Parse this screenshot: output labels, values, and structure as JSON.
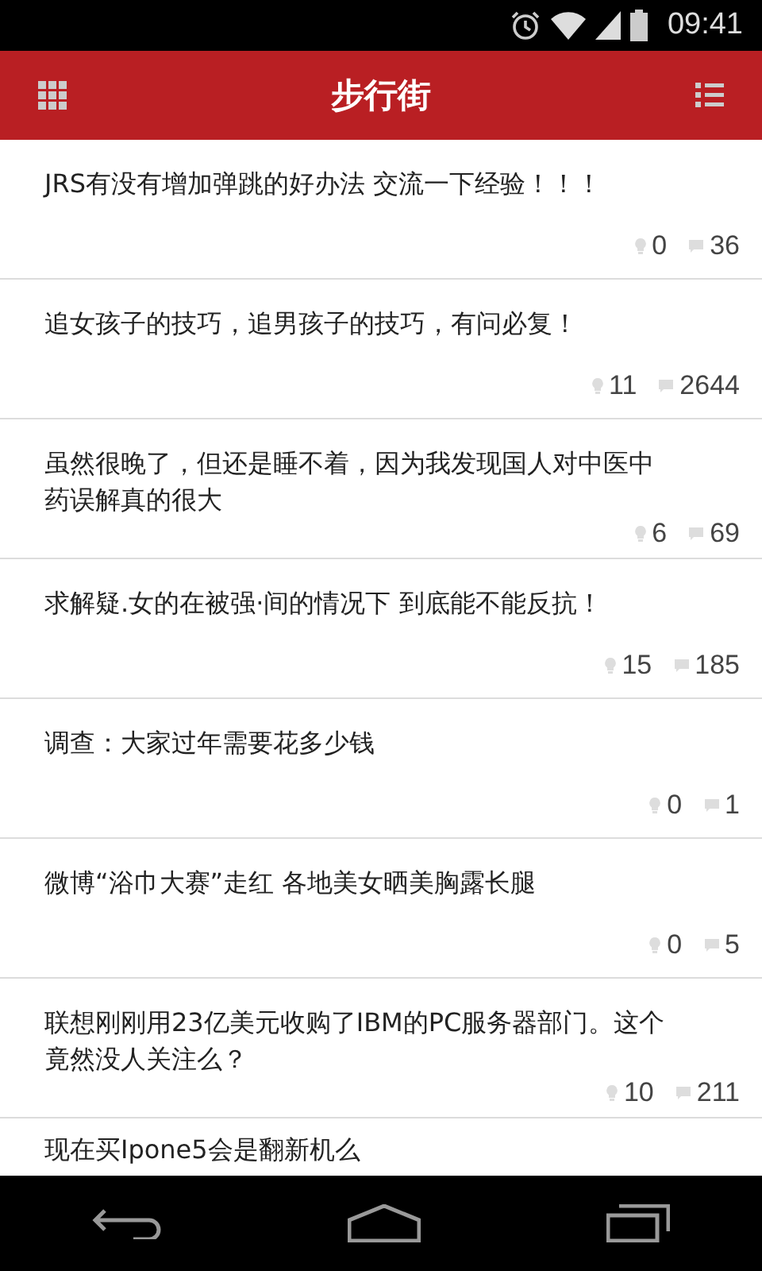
{
  "status_bar": {
    "time": "09:41"
  },
  "header": {
    "title": "步行街"
  },
  "posts": [
    {
      "title": "JRS有没有增加弹跳的好办法 交流一下经验！！！",
      "likes": "0",
      "replies": "36"
    },
    {
      "title": "追女孩子的技巧，追男孩子的技巧，有问必复！",
      "likes": "11",
      "replies": "2644"
    },
    {
      "title": "虽然很晚了，但还是睡不着，因为我发现国人对中医中药误解真的很大",
      "likes": "6",
      "replies": "69"
    },
    {
      "title": "求解疑.女的在被强·间的情况下 到底能不能反抗！",
      "likes": "15",
      "replies": "185"
    },
    {
      "title": "调查：大家过年需要花多少钱",
      "likes": "0",
      "replies": "1"
    },
    {
      "title": "微博“浴巾大赛”走红 各地美女晒美胸露长腿",
      "likes": "0",
      "replies": "5"
    },
    {
      "title": "联想刚刚用23亿美元收购了IBM的PC服务器部门。这个竟然没人关注么？",
      "likes": "10",
      "replies": "211"
    },
    {
      "title": "现在买Ipone5会是翻新机么"
    }
  ]
}
